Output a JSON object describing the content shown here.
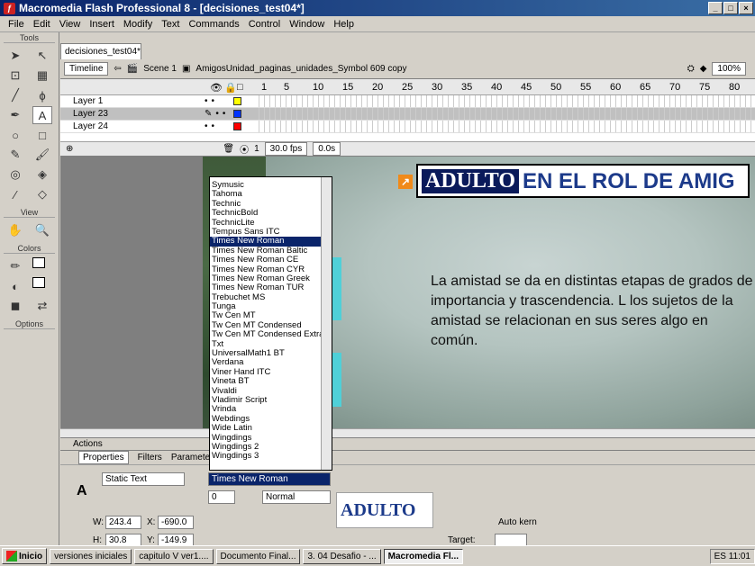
{
  "window": {
    "title": "Macromedia Flash Professional 8 - [decisiones_test04*]",
    "min_glyph": "_",
    "max_glyph": "□",
    "close_glyph": "×"
  },
  "menu": [
    "File",
    "Edit",
    "View",
    "Insert",
    "Modify",
    "Text",
    "Commands",
    "Control",
    "Window",
    "Help"
  ],
  "tools": {
    "header": "Tools",
    "view_header": "View",
    "colors_header": "Colors",
    "options_header": "Options"
  },
  "document": {
    "tab_label": "decisiones_test04*",
    "timeline_button": "Timeline",
    "back_glyph": "⇦",
    "scene": "Scene 1",
    "symbol": "AmigosUnidad_paginas_unidades_Symbol 609 copy",
    "zoom": "100%"
  },
  "timeline": {
    "ruler": [
      "1",
      "5",
      "10",
      "15",
      "20",
      "25",
      "30",
      "35",
      "40",
      "45",
      "50",
      "55",
      "60",
      "65",
      "70",
      "75",
      "80"
    ],
    "layers": [
      {
        "name": "Layer 1",
        "color": "#ffff00",
        "selected": false
      },
      {
        "name": "Layer 23",
        "color": "#0033ff",
        "selected": true
      },
      {
        "name": "Layer 24",
        "color": "#ff0000",
        "selected": false
      }
    ],
    "frame": "1",
    "fps": "30.0 fps",
    "time": "0.0s"
  },
  "stage": {
    "title_word1": "ADULTO",
    "title_rest": "EN EL ROL DE AMIG",
    "body": "La amistad se da en distintas etapas de grados de importancia y trascendencia. L los sujetos de la amistad se relacionan en sus seres algo en común."
  },
  "font_dropdown": {
    "items": [
      "Symusic",
      "Tahoma",
      "Technic",
      "TechnicBold",
      "TechnicLite",
      "Tempus Sans ITC",
      "Times New Roman",
      "Times New Roman Baltic",
      "Times New Roman CE",
      "Times New Roman CYR",
      "Times New Roman Greek",
      "Times New Roman TUR",
      "Trebuchet MS",
      "Tunga",
      "Tw Cen MT",
      "Tw Cen MT Condensed",
      "Tw Cen MT Condensed Extra B",
      "Txt",
      "UniversalMath1 BT",
      "Verdana",
      "Viner Hand ITC",
      "Vineta BT",
      "Vivaldi",
      "Vladimir Script",
      "Vrinda",
      "Webdings",
      "Wide Latin",
      "Wingdings",
      "Wingdings 2",
      "Wingdings 3"
    ],
    "selected": "Times New Roman"
  },
  "panels": {
    "actions": "Actions",
    "tabs": [
      "Properties",
      "Filters",
      "Parameters"
    ]
  },
  "properties": {
    "text_type": "Static Text",
    "font": "Times New Roman",
    "letter_spacing": "0",
    "kerning": "Normal",
    "preview": "ADULTO",
    "w": "243.4",
    "x": "-690.0",
    "h": "30.8",
    "y": "-149.9",
    "auto_kern": "Auto kern",
    "target": "Target:",
    "w_label": "W:",
    "x_label": "X:",
    "h_label": "H:",
    "y_label": "Y:",
    "type_icon": "A"
  },
  "taskbar": {
    "start": "Inicio",
    "items": [
      "versiones iniciales",
      "capitulo V ver1....",
      "Documento Final...",
      "3. 04 Desafio - ...",
      "Macromedia Fl..."
    ],
    "lang": "ES",
    "clock": "11:01"
  }
}
